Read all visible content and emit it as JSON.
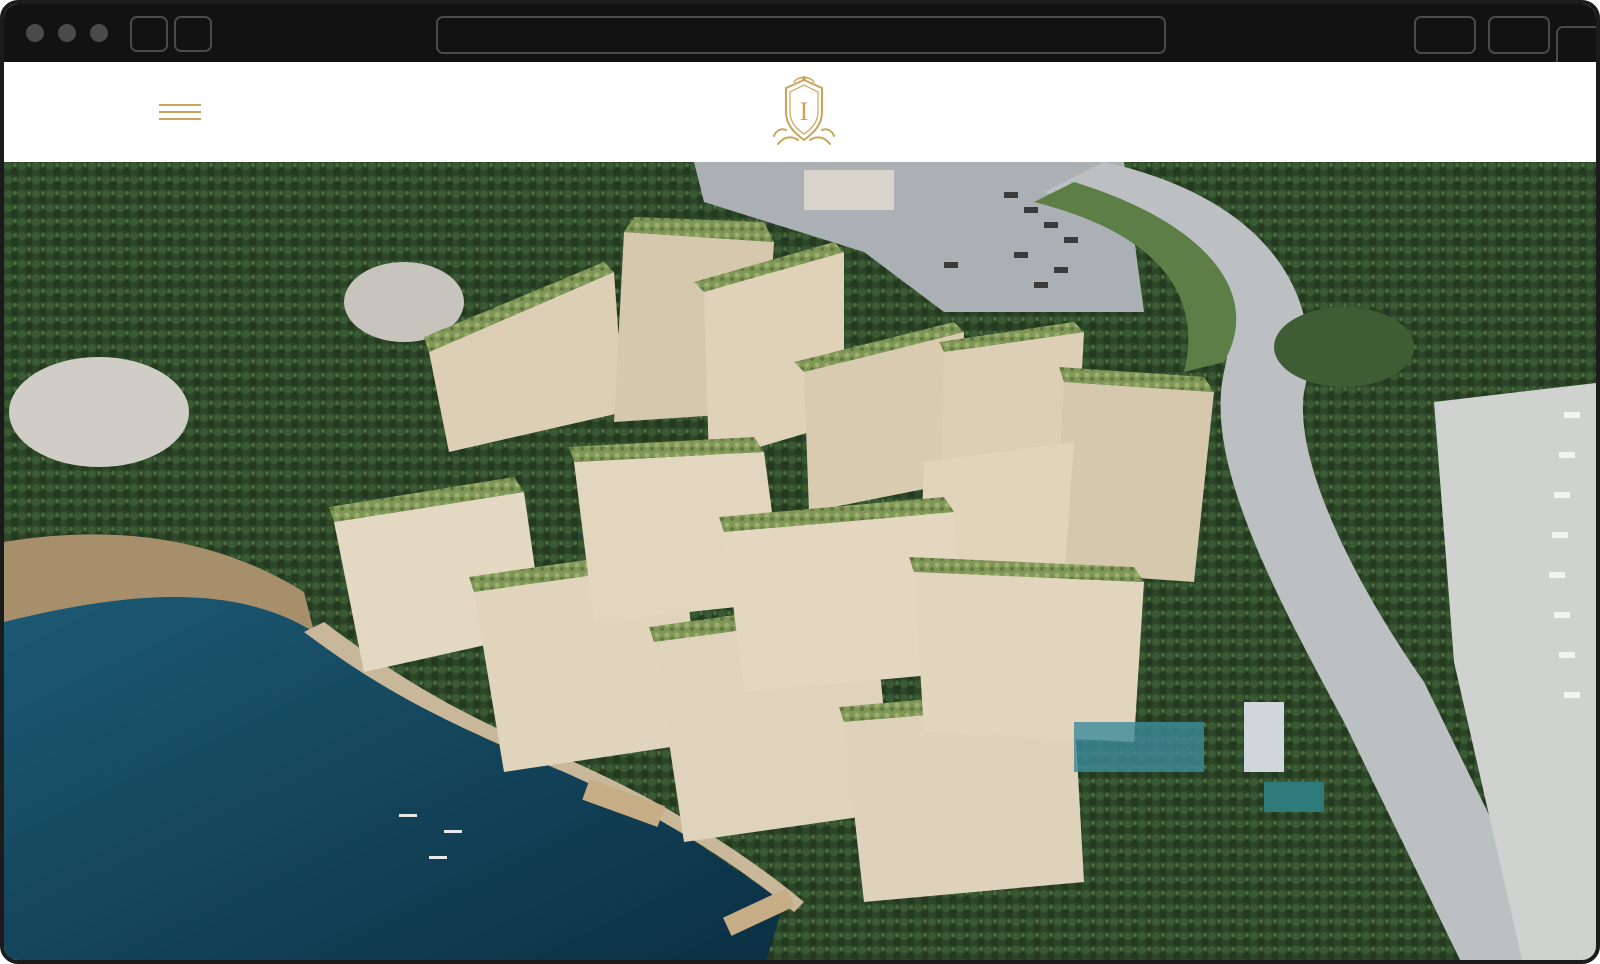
{
  "browser": {
    "window_controls": [
      "close",
      "minimize",
      "maximize"
    ],
    "address_bar_value": ""
  },
  "header": {
    "menu_icon": "hamburger-menu-icon",
    "logo_icon": "crest-monogram-icon",
    "logo_letter": "I",
    "accent_color": "#c9a45a"
  },
  "hero": {
    "image_description_icon": "aerial-render-image",
    "colors": {
      "water": "#0f3f55",
      "forest": "#2f4a2c",
      "building": "#d9ccb3",
      "road": "#b9bdbf",
      "green_roof": "#6f8a4a"
    }
  }
}
